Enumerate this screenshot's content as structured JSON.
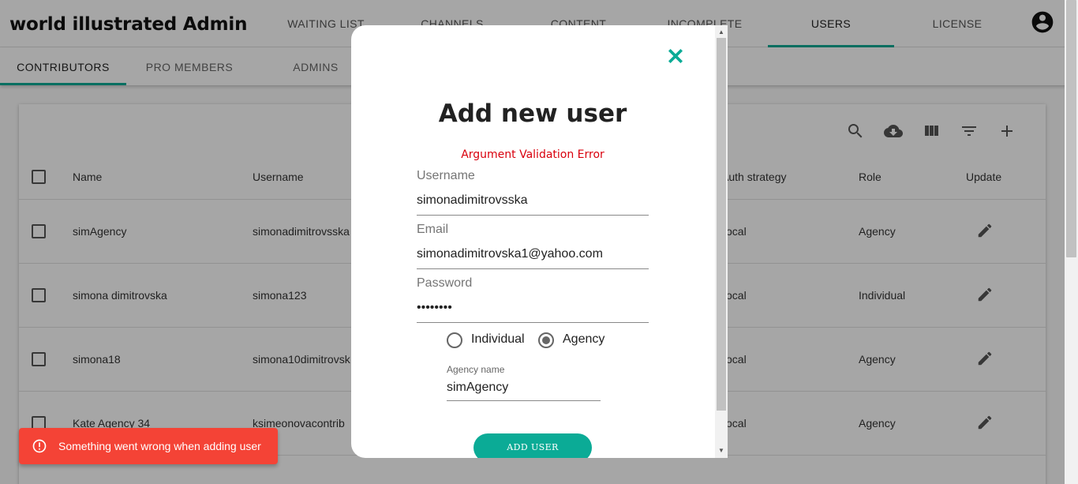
{
  "app": {
    "title": "world illustrated Admin"
  },
  "nav": {
    "tabs": [
      {
        "label": "WAITING LIST"
      },
      {
        "label": "CHANNELS"
      },
      {
        "label": "CONTENT"
      },
      {
        "label": "INCOMPLETE"
      },
      {
        "label": "USERS"
      },
      {
        "label": "LICENSE"
      }
    ],
    "active": "USERS"
  },
  "subnav": {
    "tabs": [
      {
        "label": "CONTRIBUTORS"
      },
      {
        "label": "PRO MEMBERS"
      },
      {
        "label": "ADMINS"
      }
    ],
    "active": "CONTRIBUTORS"
  },
  "toolbar": {
    "icons": [
      "search-icon",
      "cloud-download-icon",
      "view-column-icon",
      "filter-list-icon",
      "add-icon"
    ]
  },
  "table": {
    "columns": {
      "name": "Name",
      "username": "Username",
      "auth": "Auth strategy",
      "role": "Role",
      "update": "Update"
    },
    "rows": [
      {
        "name": "simAgency",
        "username": "simonadimitrovsska",
        "auth": "ocal",
        "role": "Agency"
      },
      {
        "name": "simona dimitrovska",
        "username": "simona123",
        "auth": "ocal",
        "role": "Individual"
      },
      {
        "name": "simona18",
        "username": "simona10dimitrovsk",
        "auth": "ocal",
        "role": "Agency"
      },
      {
        "name": "Kate Agency 34",
        "username": "ksimeonovacontrib",
        "auth": "ocal",
        "role": "Agency"
      }
    ]
  },
  "modal": {
    "title": "Add new user",
    "error": "Argument Validation Error",
    "username_label": "Username",
    "username_value": "simonadimitrovsska",
    "email_label": "Email",
    "email_value": "simonadimitrovska1@yahoo.com",
    "password_label": "Password",
    "password_value": "••••••••",
    "radio_individual": "Individual",
    "radio_agency": "Agency",
    "selected_type": "Agency",
    "agency_label": "Agency name",
    "agency_value": "simAgency",
    "submit_label": "ADD USER"
  },
  "toast": {
    "message": "Something went wrong when adding user"
  },
  "colors": {
    "accent": "#0bab96",
    "error": "#d9000d",
    "toast": "#f44336"
  }
}
